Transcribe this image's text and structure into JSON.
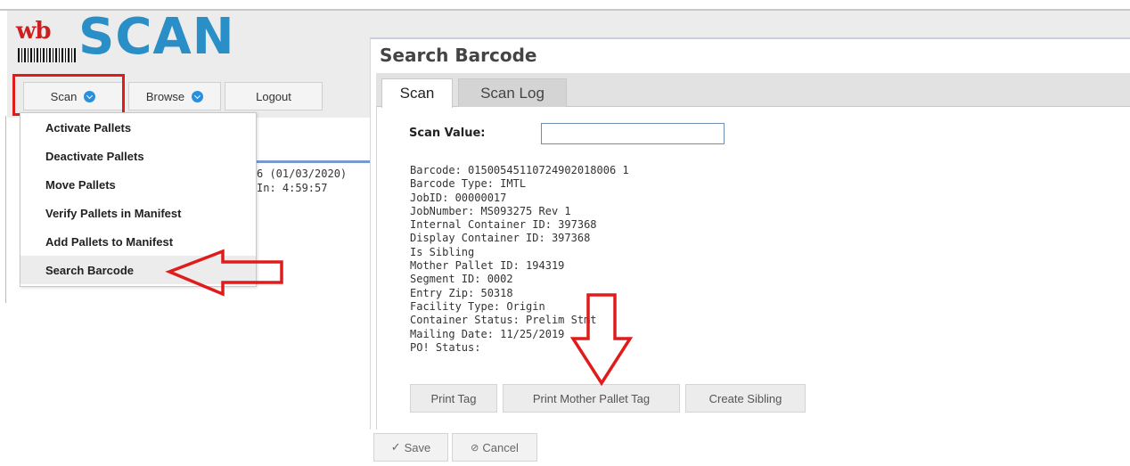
{
  "logo": {
    "prefix": "wb",
    "name": "SCAN"
  },
  "nav": {
    "scan_label": "Scan",
    "browse_label": "Browse",
    "logout_label": "Logout"
  },
  "scan_menu": {
    "items": [
      {
        "label": "Activate Pallets"
      },
      {
        "label": "Deactivate Pallets"
      },
      {
        "label": "Move Pallets"
      },
      {
        "label": "Verify Pallets in Manifest"
      },
      {
        "label": "Add Pallets to Manifest"
      },
      {
        "label": "Search Barcode"
      }
    ]
  },
  "background_fragments": {
    "date_text": "6 (01/03/2020)",
    "time_text": "In: 4:59:57"
  },
  "dialog": {
    "title": "Search Barcode",
    "tabs": [
      {
        "label": "Scan",
        "active": true
      },
      {
        "label": "Scan Log",
        "active": false
      }
    ],
    "scan_value_label": "Scan Value:",
    "scan_value": "",
    "details": [
      "Barcode: 01500545110724902018006 1",
      "Barcode Type: IMTL",
      "JobID: 00000017",
      "JobNumber: MS093275 Rev 1",
      "Internal Container ID: 397368",
      "Display Container ID: 397368",
      "Is Sibling",
      "Mother Pallet ID: 194319",
      "Segment ID: 0002",
      "Entry Zip: 50318",
      "Facility Type: Origin",
      "Container Status: Prelim Stmt",
      "Mailing Date: 11/25/2019",
      "PO! Status:"
    ],
    "buttons": {
      "print_tag": "Print Tag",
      "print_mother_pallet_tag": "Print Mother Pallet Tag",
      "create_sibling": "Create Sibling"
    }
  },
  "footer": {
    "save_label": "Save",
    "cancel_label": "Cancel",
    "save_icon": "check-icon",
    "cancel_icon": "cancel-circle-icon"
  },
  "colors": {
    "accent_blue": "#2a8fc7",
    "annotation_red": "#e01b1b",
    "logo_red": "#cc1f1f"
  }
}
